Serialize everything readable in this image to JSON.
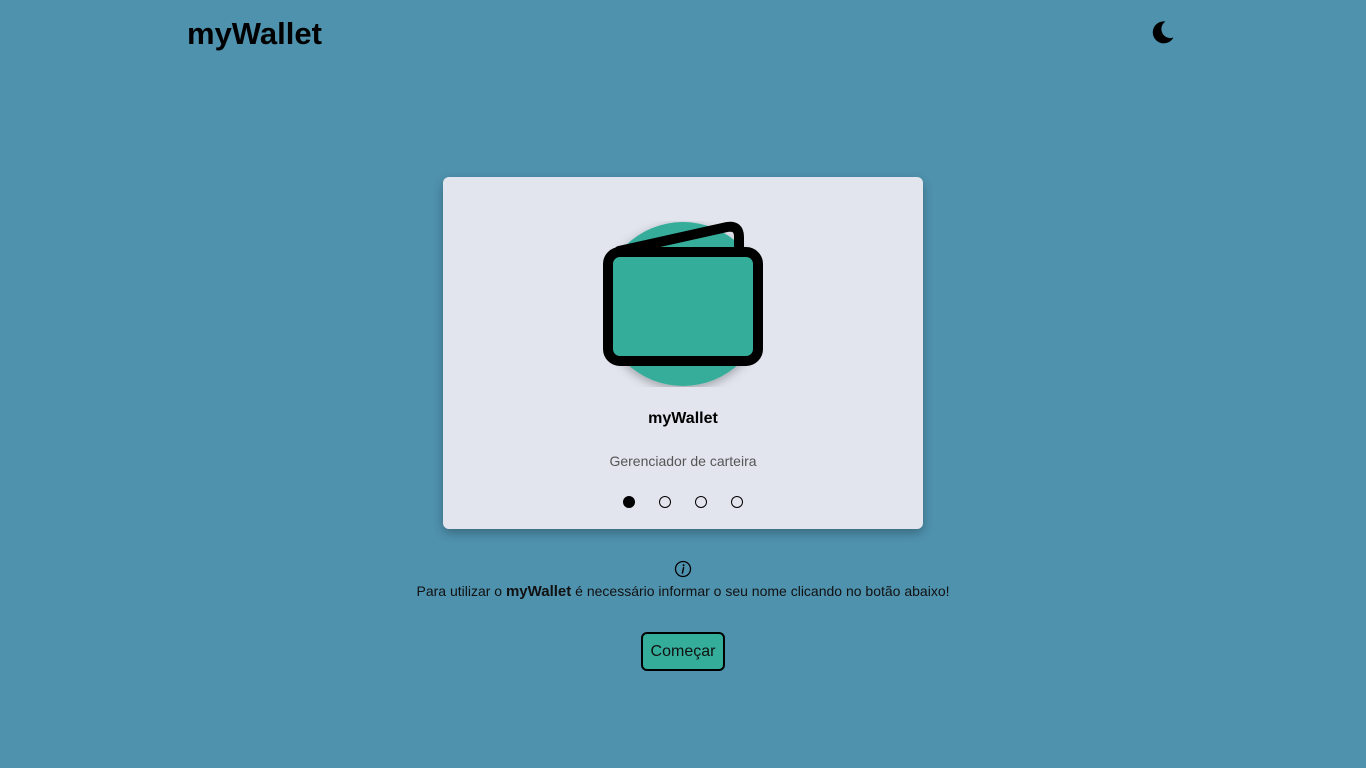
{
  "header": {
    "brand": "myWallet",
    "theme_toggle_icon": "moon-icon"
  },
  "card": {
    "illustration_icon": "wallet-icon",
    "title": "myWallet",
    "subtitle": "Gerenciador de carteira",
    "pagination": {
      "total": 4,
      "active_index": 0
    }
  },
  "info": {
    "icon": "info-icon",
    "text_before": "Para utilizar o ",
    "text_strong": "myWallet",
    "text_after": " é necessário informar o seu nome clicando no botão abaixo!"
  },
  "actions": {
    "start_label": "Começar"
  },
  "colors": {
    "background": "#4f92ae",
    "card": "#e2e5ee",
    "accent": "#34ad9a"
  }
}
